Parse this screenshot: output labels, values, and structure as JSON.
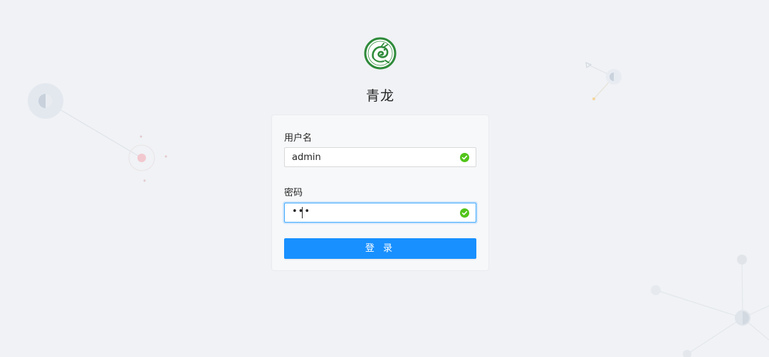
{
  "app": {
    "title": "青龙"
  },
  "form": {
    "username_label": "用户名",
    "username_value": "admin",
    "password_label": "密码",
    "password_mask": "•••",
    "login_label": "登 录"
  },
  "colors": {
    "primary": "#1890ff",
    "success": "#52c41a",
    "logo_green": "#2e8b3a",
    "background": "#f0f2f5"
  },
  "icons": {
    "logo": "qinglong-logo",
    "username_status": "check-circle-icon",
    "password_status": "check-circle-icon"
  }
}
